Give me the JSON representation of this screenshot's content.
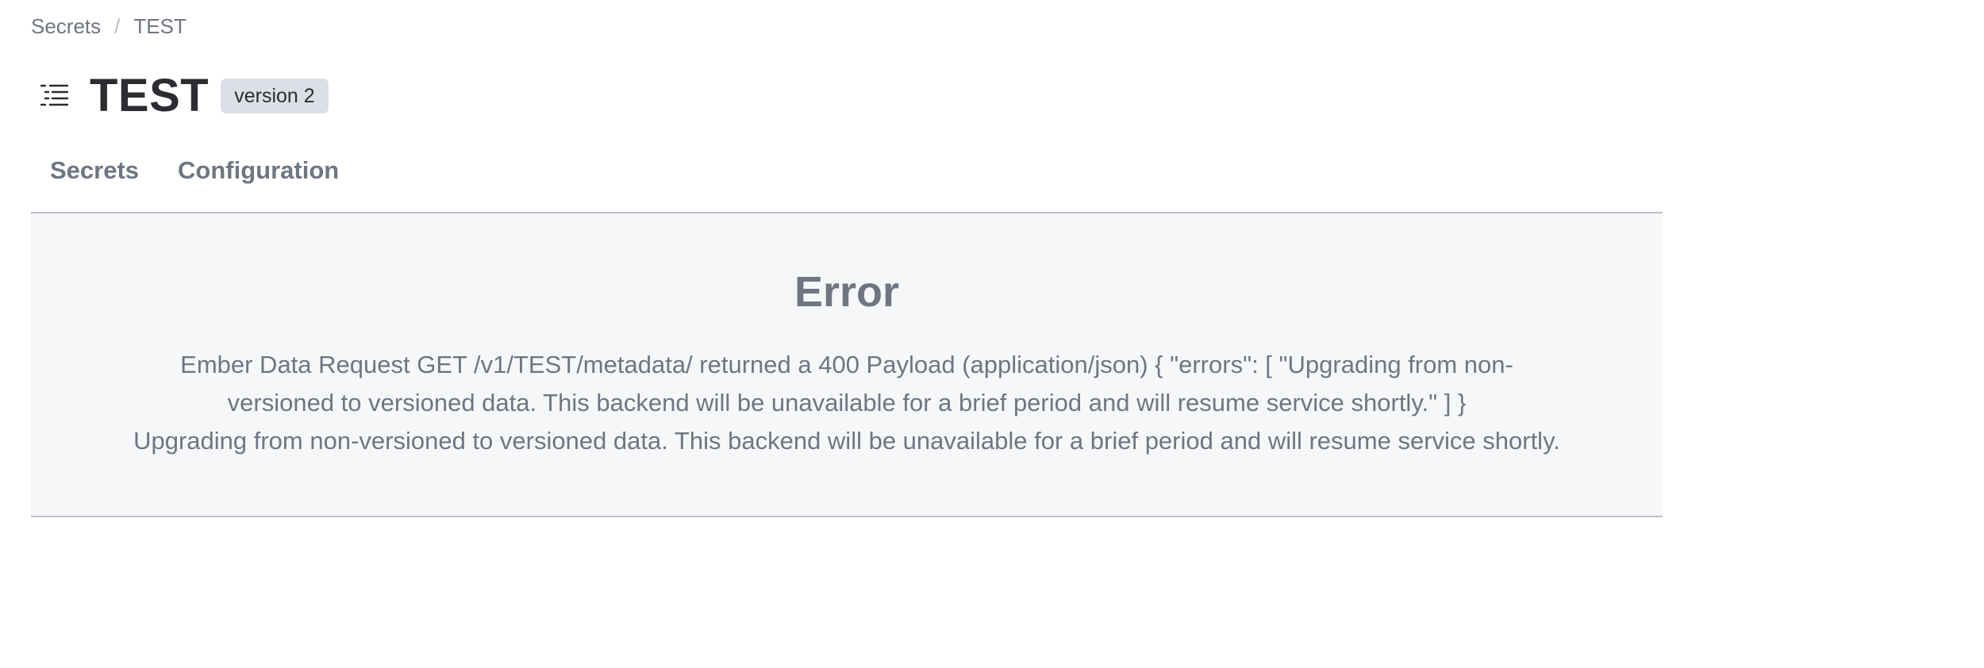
{
  "breadcrumb": {
    "items": [
      {
        "label": "Secrets"
      },
      {
        "label": "TEST"
      }
    ],
    "separator": "/"
  },
  "header": {
    "icon": "list-icon",
    "title": "TEST",
    "badge": "version 2"
  },
  "tabs": [
    {
      "label": "Secrets"
    },
    {
      "label": "Configuration"
    }
  ],
  "error": {
    "title": "Error",
    "message": "Ember Data Request GET /v1/TEST/metadata/ returned a 400 Payload (application/json) { \"errors\": [ \"Upgrading from non-versioned to versioned data. This backend will be unavailable for a brief period and will resume service shortly.\" ] }",
    "detail": "Upgrading from non-versioned to versioned data. This backend will be unavailable for a brief period and will resume service shortly."
  },
  "colors": {
    "muted_text": "#6f7682",
    "title_text": "#2b2d31",
    "badge_bg": "#dce0e6",
    "panel_bg": "#f6f7f9",
    "border": "#b9bec7"
  }
}
